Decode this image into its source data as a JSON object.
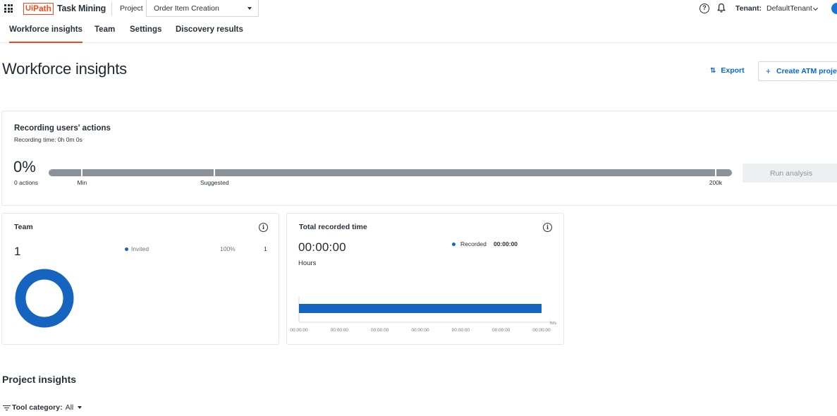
{
  "header": {
    "logo_prefix": "Ui",
    "logo_suffix": "Path",
    "product": "Task Mining",
    "project_label": "Project",
    "project_value": "Order Item Creation",
    "help_glyph": "?",
    "tenant_label": "Tenant:",
    "tenant_value": "DefaultTenant"
  },
  "tabs": [
    {
      "label": "Workforce insights",
      "active": true
    },
    {
      "label": "Team",
      "active": false
    },
    {
      "label": "Settings",
      "active": false
    },
    {
      "label": "Discovery results",
      "active": false
    }
  ],
  "page": {
    "title": "Workforce insights",
    "export_icon": "⇅",
    "export_label": "Export",
    "create_plus": "+",
    "create_label": "Create ATM project"
  },
  "recording": {
    "title": "Recording users' actions",
    "time": "Recording time: 0h 0m 0s",
    "percent": "0%",
    "progress_fraction": 0,
    "actions": "0 actions",
    "markers": [
      {
        "label": "Min",
        "fraction": 0.049
      },
      {
        "label": "Suggested",
        "fraction": 0.243
      },
      {
        "label": "200k",
        "fraction": 0.976
      }
    ],
    "run_label": "Run analysis"
  },
  "team_card": {
    "title": "Team",
    "info_glyph": "i",
    "count": "1",
    "legend_label": "Invited",
    "legend_pct": "100%",
    "legend_value": "1",
    "chart_data": {
      "type": "pie",
      "categories": [
        "Invited"
      ],
      "values": [
        1
      ],
      "colors": [
        "#1565c0"
      ]
    }
  },
  "time_card": {
    "title": "Total recorded time",
    "info_glyph": "i",
    "value": "00:00:00",
    "unit": "Hours",
    "legend_label": "Recorded",
    "legend_value": "00:00:00",
    "chart_data": {
      "type": "bar",
      "categories": [
        "Recorded"
      ],
      "values": [
        0
      ],
      "x_ticks": [
        "00:00:00",
        "00:00:00",
        "00:00:00",
        "00:00:00",
        "00:00:00",
        "00:00:00",
        "00:00:00"
      ],
      "x_unit": "hrs",
      "color": "#1565c0"
    }
  },
  "insights": {
    "title": "Project insights",
    "filter_label": "Tool category:",
    "filter_value": "All"
  },
  "colors": {
    "brand": "#fa4616",
    "accent": "#0067df",
    "chart_blue": "#1565c0",
    "track_gray": "#8a9399"
  }
}
